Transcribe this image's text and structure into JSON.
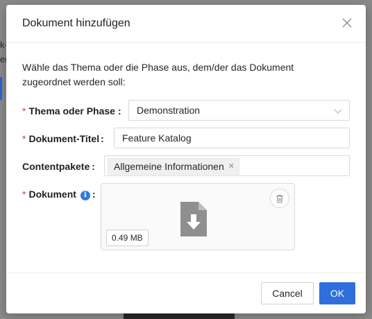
{
  "background": {
    "fragment_1": "k-",
    "fragment_2": "er"
  },
  "modal": {
    "title": "Dokument hinzufügen",
    "description": "Wähle das Thema oder die Phase aus, dem/der das Dokument zugeordnet werden soll:"
  },
  "form": {
    "required_marker": "*",
    "colon": ":",
    "theme_label": "Thema oder Phase",
    "theme_value": "Demonstration",
    "title_label": "Dokument-Titel",
    "title_value": "Feature Katalog",
    "content_label": "Contentpakete",
    "content_tag": "Allgemeine Informationen",
    "document_label": "Dokument",
    "info_icon_glyph": "i",
    "file_size": "0.49 MB"
  },
  "footer": {
    "cancel_label": "Cancel",
    "ok_label": "OK"
  },
  "colors": {
    "accent": "#2f6fdc",
    "required": "#e53935"
  },
  "icons": {
    "close": "close-icon",
    "dropdown": "chevron-down-icon",
    "tag_remove": "close-icon",
    "info": "info-icon",
    "delete": "trash-icon",
    "file": "file-download-icon"
  }
}
